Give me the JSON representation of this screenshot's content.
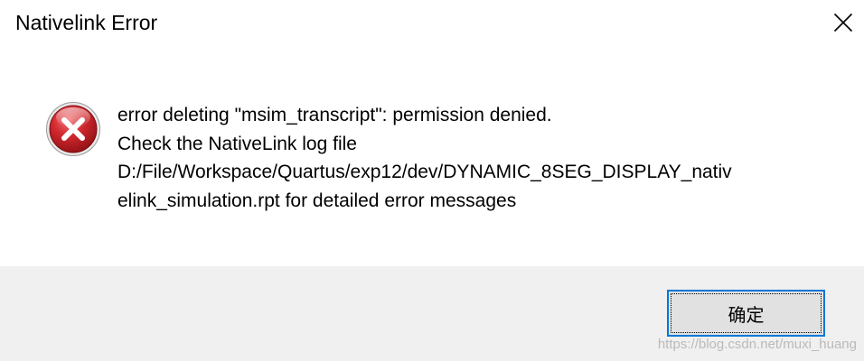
{
  "window": {
    "title": "Nativelink Error",
    "close_icon": "close-icon"
  },
  "message": {
    "icon": "error-icon",
    "lines": [
      "error deleting \"msim_transcript\": permission denied.",
      "Check the NativeLink log file",
      "D:/File/Workspace/Quartus/exp12/dev/DYNAMIC_8SEG_DISPLAY_nativ",
      "elink_simulation.rpt for detailed error messages"
    ]
  },
  "buttons": {
    "ok_label": "确定"
  },
  "watermark": {
    "text": "https://blog.csdn.net/muxi_huang"
  },
  "colors": {
    "footer_bg": "#f0f0f0",
    "button_border_focus": "#0078d7",
    "error_red": "#c0262b"
  }
}
